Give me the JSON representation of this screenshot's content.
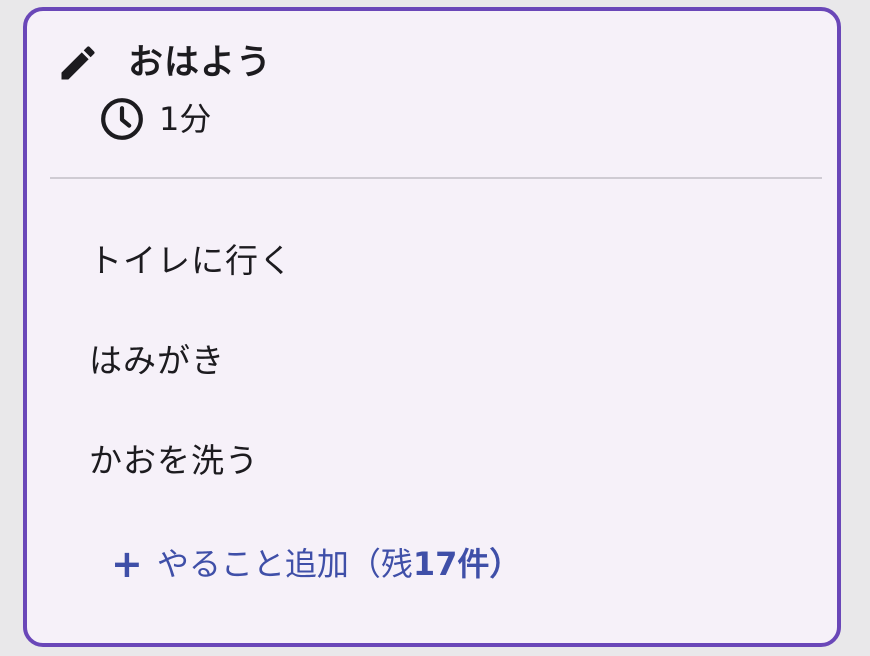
{
  "routine": {
    "title": "おはよう",
    "duration": "1分",
    "edit_icon": "pencil-icon",
    "clock_icon": "clock-icon"
  },
  "tasks": [
    {
      "label": "トイレに行く"
    },
    {
      "label": "はみがき"
    },
    {
      "label": "かおを洗う"
    }
  ],
  "add_task": {
    "icon": "plus-icon",
    "label": "やること追加（残",
    "remaining": "17",
    "suffix": "件）"
  },
  "colors": {
    "border": "#6a47b8",
    "card_background": "#f6f1f9",
    "accent": "#3f4fa8",
    "text": "#1c1b1f"
  }
}
